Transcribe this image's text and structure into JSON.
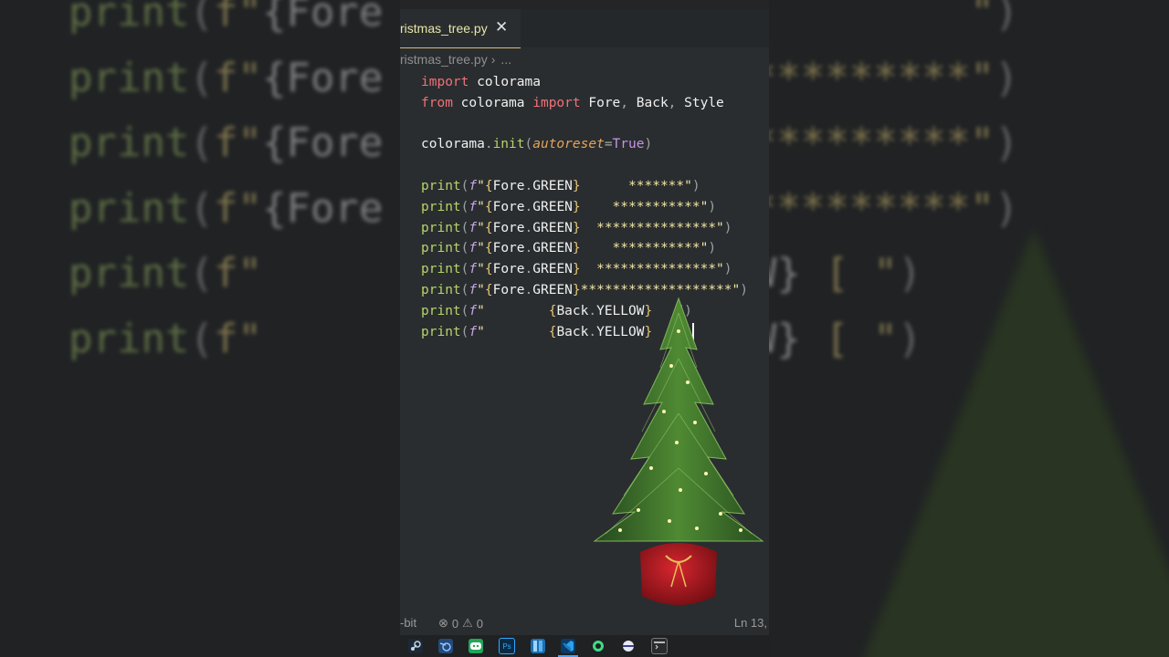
{
  "editor": {
    "tab_label": "ristmas_tree.py",
    "tab_close": "✕",
    "breadcrumb_file": "ristmas_tree.py",
    "breadcrumb_sep": "›",
    "breadcrumb_more": "..."
  },
  "code_lines": [
    "import colorama",
    "from colorama import Fore, Back, Style",
    "",
    "colorama.init(autoreset=True)",
    "",
    "print(f\"{Fore.GREEN}      *******\")",
    "print(f\"{Fore.GREEN}    ***********\")",
    "print(f\"{Fore.GREEN}  ***************\")",
    "print(f\"{Fore.GREEN}    ***********\")",
    "print(f\"{Fore.GREEN}  ***************\")",
    "print(f\"{Fore.GREEN}*******************\")",
    "print(f\"        {Back.YELLOW}   \")",
    "print(f\"        {Back.YELLOW}   \")"
  ],
  "status": {
    "encoding": "-bit",
    "errors": "0",
    "warnings": "0",
    "position": "Ln 13,"
  },
  "taskbar": {
    "icons": [
      "steam-icon",
      "blender-icon",
      "discord-icon",
      "photoshop-icon",
      "files-icon",
      "vscode-icon",
      "android-studio-icon",
      "obs-icon",
      "terminal-icon"
    ],
    "photoshop_label": "Ps"
  },
  "colors": {
    "panel_bg": "#2a2d2f",
    "keyword": "#f07178",
    "function": "#b5d36a",
    "string": "#f2e6a4",
    "tab_accent": "#d7ba7d"
  }
}
